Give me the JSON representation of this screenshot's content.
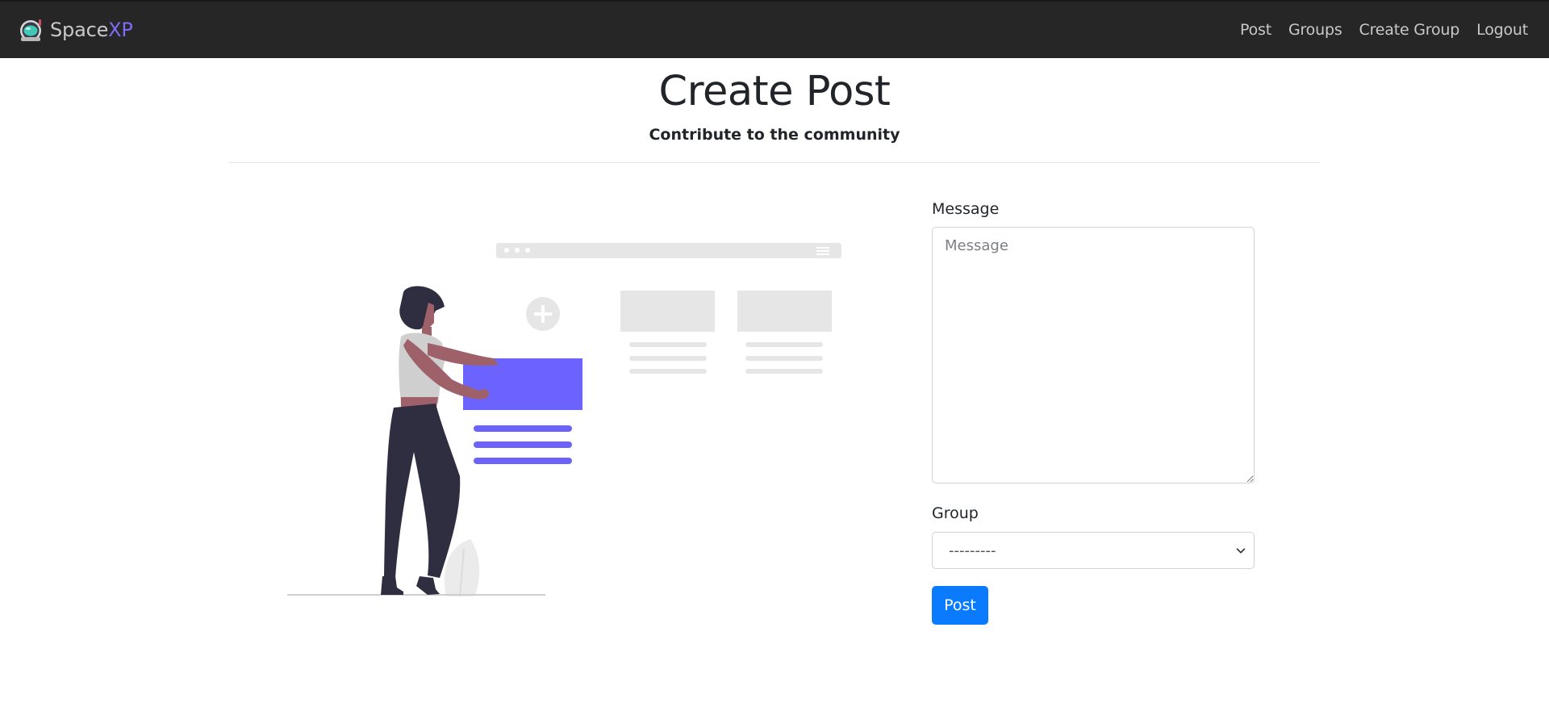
{
  "navbar": {
    "brand": {
      "name": "Space",
      "accent": "XP",
      "logo_icon": "astronaut-helmet-icon"
    },
    "links": [
      {
        "label": "Post"
      },
      {
        "label": "Groups"
      },
      {
        "label": "Create Group"
      },
      {
        "label": "Logout"
      }
    ]
  },
  "header": {
    "title": "Create Post",
    "subtitle": "Contribute to the community"
  },
  "form": {
    "message_label": "Message",
    "message_placeholder": "Message",
    "message_value": "",
    "group_label": "Group",
    "group_selected": "---------",
    "submit_label": "Post"
  },
  "colors": {
    "navbar_bg": "#262626",
    "brand_accent": "#7b6cf6",
    "illustration_accent": "#6c63ff",
    "primary_button": "#0a7bff"
  }
}
